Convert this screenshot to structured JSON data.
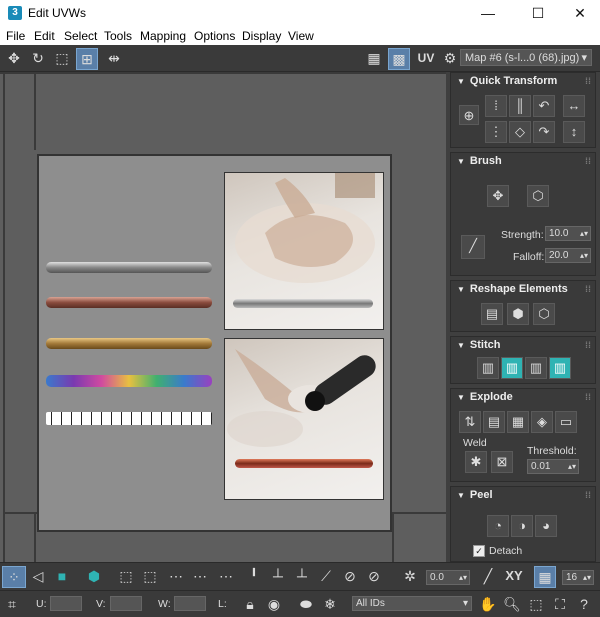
{
  "window": {
    "title": "Edit UVWs",
    "app_icon": "3",
    "minimize": "—",
    "maximize": "☐",
    "close": "✕"
  },
  "menu": [
    "File",
    "Edit",
    "Select",
    "Tools",
    "Mapping",
    "Options",
    "Display",
    "View"
  ],
  "toolbar": {
    "uv_label": "UV",
    "map_select": "Map #6 (s-l...0 (68).jpg)"
  },
  "panel": {
    "quick_transform": {
      "title": "Quick Transform"
    },
    "brush": {
      "title": "Brush",
      "strength_label": "Strength:",
      "strength_value": "10.0",
      "falloff_label": "Falloff:",
      "falloff_value": "20.0"
    },
    "reshape": {
      "title": "Reshape Elements"
    },
    "stitch": {
      "title": "Stitch"
    },
    "explode": {
      "title": "Explode",
      "weld_label": "Weld",
      "threshold_label": "Threshold:",
      "threshold_value": "0.01"
    },
    "peel": {
      "title": "Peel",
      "detach_label": "Detach"
    }
  },
  "bottom": {
    "spin_value": "0.0",
    "xy_label": "XY",
    "grid_value": "16"
  },
  "status": {
    "u_label": "U:",
    "v_label": "V:",
    "w_label": "W:",
    "l_label": "L:",
    "ids_value": "All IDs"
  },
  "colors": {
    "accent_teal": "#2fb3b3",
    "selected_blue": "#5a7fa8"
  }
}
